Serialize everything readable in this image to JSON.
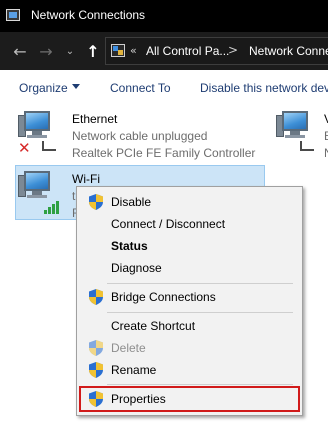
{
  "window": {
    "title": "Network Connections"
  },
  "nav": {
    "back_glyph": "←",
    "forward_glyph": "→",
    "dropdown_glyph": "⌄",
    "up_glyph": "↑",
    "breadcrumb_overflow": "«",
    "breadcrumb": [
      "All Control Pa...",
      "Network Conne"
    ],
    "breadcrumb_separator": ">"
  },
  "commands": {
    "organize": "Organize",
    "connect_to": "Connect To",
    "disable_device": "Disable this network dev"
  },
  "adapters": {
    "ethernet": {
      "name": "Ethernet",
      "status": "Network cable unplugged",
      "device": "Realtek PCIe FE Family Controller",
      "badge_glyph": "✕"
    },
    "wifi": {
      "name": "Wi-Fi",
      "status_partial": "t",
      "device_partial": "R"
    },
    "third": {
      "name_partial": "V",
      "status_partial": "E",
      "device_partial": "N"
    }
  },
  "context_menu": {
    "items": [
      {
        "label": "Disable",
        "icon": "uac-shield-icon"
      },
      {
        "label": "Connect / Disconnect",
        "icon": ""
      },
      {
        "label": "Status",
        "icon": "",
        "bold": true
      },
      {
        "label": "Diagnose",
        "icon": ""
      },
      {
        "label": "Bridge Connections",
        "icon": "uac-shield-icon"
      },
      {
        "label": "Create Shortcut",
        "icon": ""
      },
      {
        "label": "Delete",
        "icon": "uac-shield-icon",
        "disabled": true
      },
      {
        "label": "Rename",
        "icon": "uac-shield-icon"
      },
      {
        "label": "Properties",
        "icon": "uac-shield-icon",
        "highlighted": true
      }
    ]
  },
  "colors": {
    "titlebar_bg": "#000000",
    "navbar_bg": "#1c1c1c",
    "command_text": "#1e3c72",
    "selection_bg": "#cce4f7",
    "selection_border": "#99c9ef",
    "menu_bg": "#f2f2f2",
    "highlight_border": "#d11a1a",
    "error_red": "#d62a2a",
    "signal_green": "#2ea043"
  }
}
